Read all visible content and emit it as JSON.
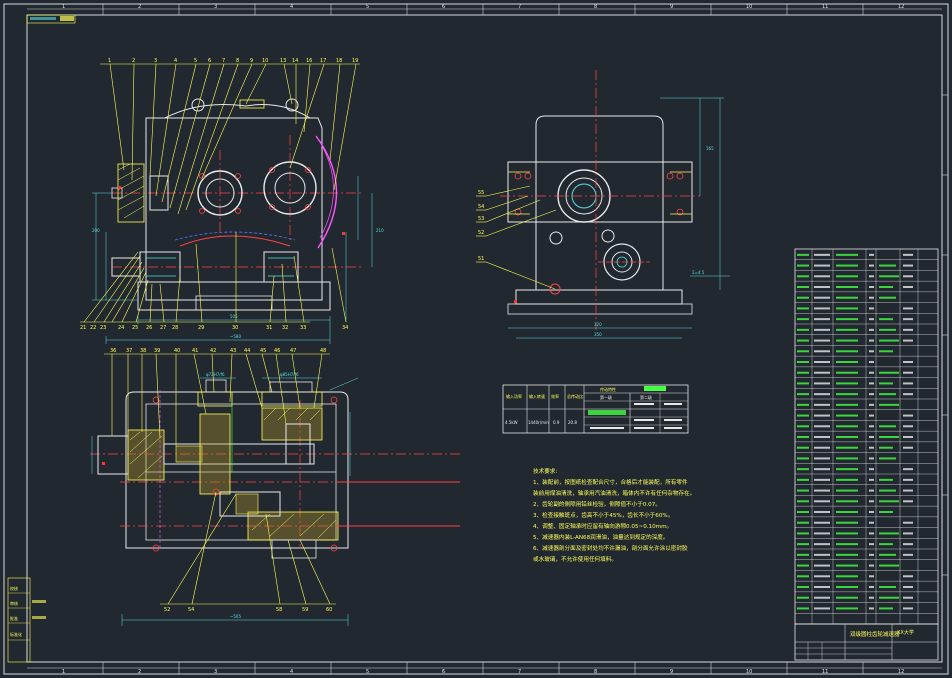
{
  "sheet": {
    "title_block_name": "双级圆柱齿轮减速器",
    "school": "XX大学",
    "zone_columns": [
      "1",
      "2",
      "3",
      "4",
      "5",
      "6",
      "7",
      "8",
      "9",
      "10",
      "11",
      "12"
    ],
    "zone_rows": [
      "A",
      "B",
      "C",
      "D",
      "E",
      "F",
      "G",
      "H"
    ]
  },
  "top_view_balloons": [
    "1",
    "2",
    "3",
    "4",
    "5",
    "6",
    "7",
    "8",
    "9",
    "10",
    "13",
    "14",
    "16",
    "17",
    "18",
    "19"
  ],
  "bottom_left_balloons": [
    "21",
    "22",
    "23",
    "24",
    "25",
    "26",
    "27",
    "28",
    "29",
    "30",
    "31",
    "32",
    "33",
    "34"
  ],
  "front_view_balloons": [
    "36",
    "37",
    "38",
    "39",
    "40",
    "41",
    "42",
    "43",
    "44",
    "45",
    "46",
    "47",
    "48"
  ],
  "lower_view_balloons": [
    "52",
    "54",
    "58",
    "59",
    "60"
  ],
  "side_view_balloons": [
    "55",
    "54",
    "53",
    "52",
    "51"
  ],
  "tech_requirements": {
    "heading": "技术要求:",
    "lines": [
      "1、装配前，按图纸检查配合尺寸，合格后才能装配，所有零件",
      "装前用煤油清洗，轴承用汽油清洗，箱体内不许有任何杂物存在。",
      "2、齿轮副的侧隙用铅丝检验，侧隙值不小于0.07。",
      "3、检查接触斑点，齿高不小于45%，齿长不小于60%。",
      "4、调整、固定轴承时应留有轴向游隙0.05~0.10mm。",
      "5、减速器内装L-AN68润滑油，油量达到规定的深度。",
      "6、减速器剖分面及密封处均不许漏油，剖分面允许涂以密封胶",
      "或水玻璃，不允许使用任何填料。"
    ]
  },
  "spec_table": {
    "headers": [
      "输入功率",
      "输入转速",
      "效率",
      "总传动比",
      "传动特性"
    ],
    "values": [
      "4.5kW",
      "1440r/min",
      "0.9",
      "20.8",
      "第一级",
      "第二级"
    ]
  },
  "left_strip_labels": [
    "校核",
    "审核",
    "批准",
    "标准化"
  ],
  "parts_list_rows": 34
}
